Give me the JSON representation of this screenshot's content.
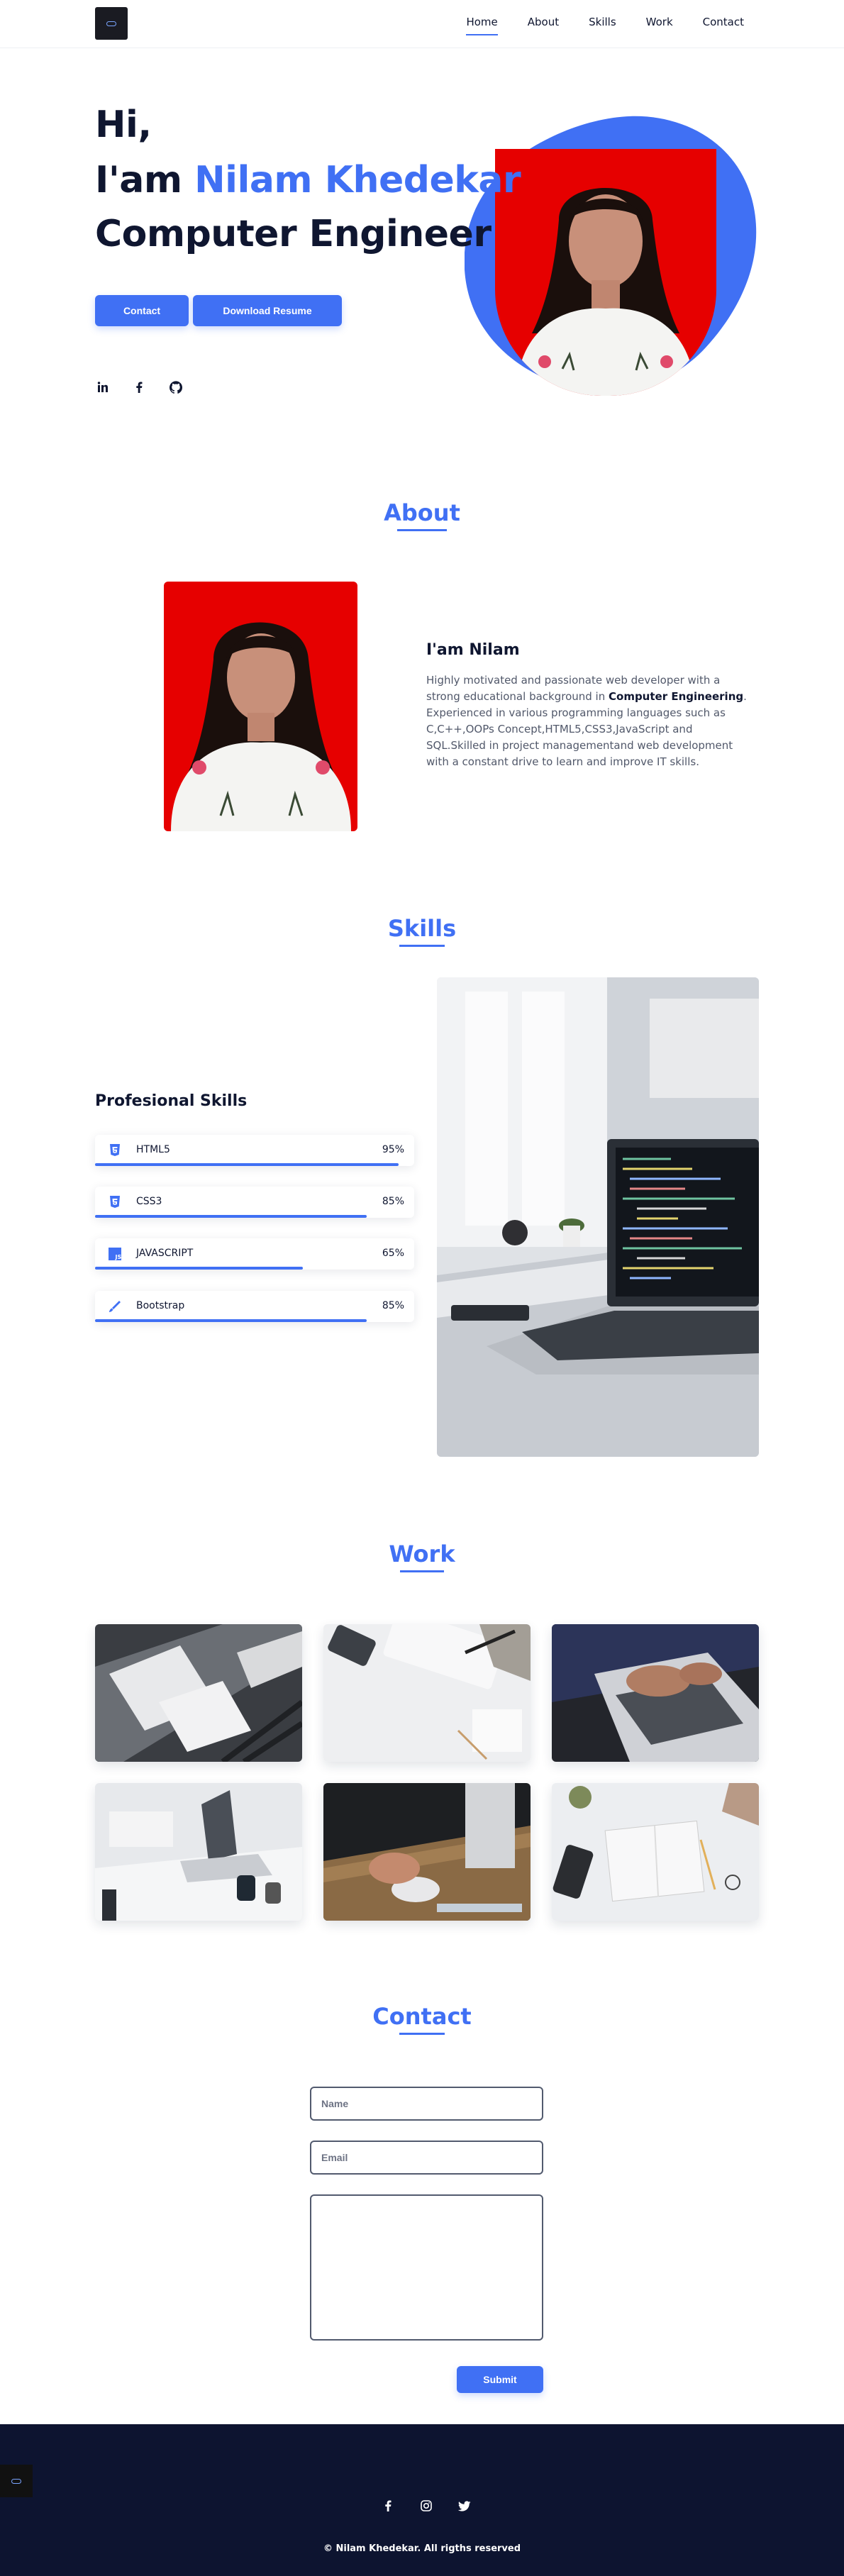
{
  "nav": {
    "items": [
      "Home",
      "About",
      "Skills",
      "Work",
      "Contact"
    ]
  },
  "hero": {
    "line1": "Hi,",
    "line2_prefix": "I'am ",
    "name": "Nilam Khedekar",
    "line3": "Computer Engineer",
    "contact_btn": "Contact",
    "resume_btn": "Download Resume",
    "social_icons": [
      "linkedin-icon",
      "facebook-icon",
      "github-icon"
    ]
  },
  "about": {
    "title": "About",
    "heading": "I'am Nilam",
    "text_before": "Highly motivated and passionate web developer with a strong educational background in ",
    "text_bold": "Computer Engineering",
    "text_after": ". Experienced in various programming languages such as C,C++,OOPs Concept,HTML5,CSS3,JavaScript and SQL.Skilled in project managementand web development with a constant drive to learn and improve IT skills."
  },
  "skills": {
    "title": "Skills",
    "heading": "Profesional Skills",
    "items": [
      {
        "name": "HTML5",
        "percent": "95%",
        "level": 0.95,
        "icon": "html5-icon"
      },
      {
        "name": "CSS3",
        "percent": "85%",
        "level": 0.85,
        "icon": "css3-icon"
      },
      {
        "name": "JAVASCRIPT",
        "percent": "65%",
        "level": 0.65,
        "icon": "javascript-icon"
      },
      {
        "name": "Bootstrap",
        "percent": "85%",
        "level": 0.85,
        "icon": "bootstrap-icon"
      }
    ]
  },
  "work": {
    "title": "Work"
  },
  "contact": {
    "title": "Contact",
    "name_placeholder": "Name",
    "email_placeholder": "Email",
    "submit": "Submit"
  },
  "footer": {
    "social_icons": [
      "facebook-icon",
      "instagram-icon",
      "twitter-icon"
    ],
    "copyright": "© Nilam Khedekar. All rigths reserved"
  },
  "colors": {
    "accent": "#4070f4",
    "dark": "#0f1630",
    "footer_bg": "#0d1430"
  }
}
